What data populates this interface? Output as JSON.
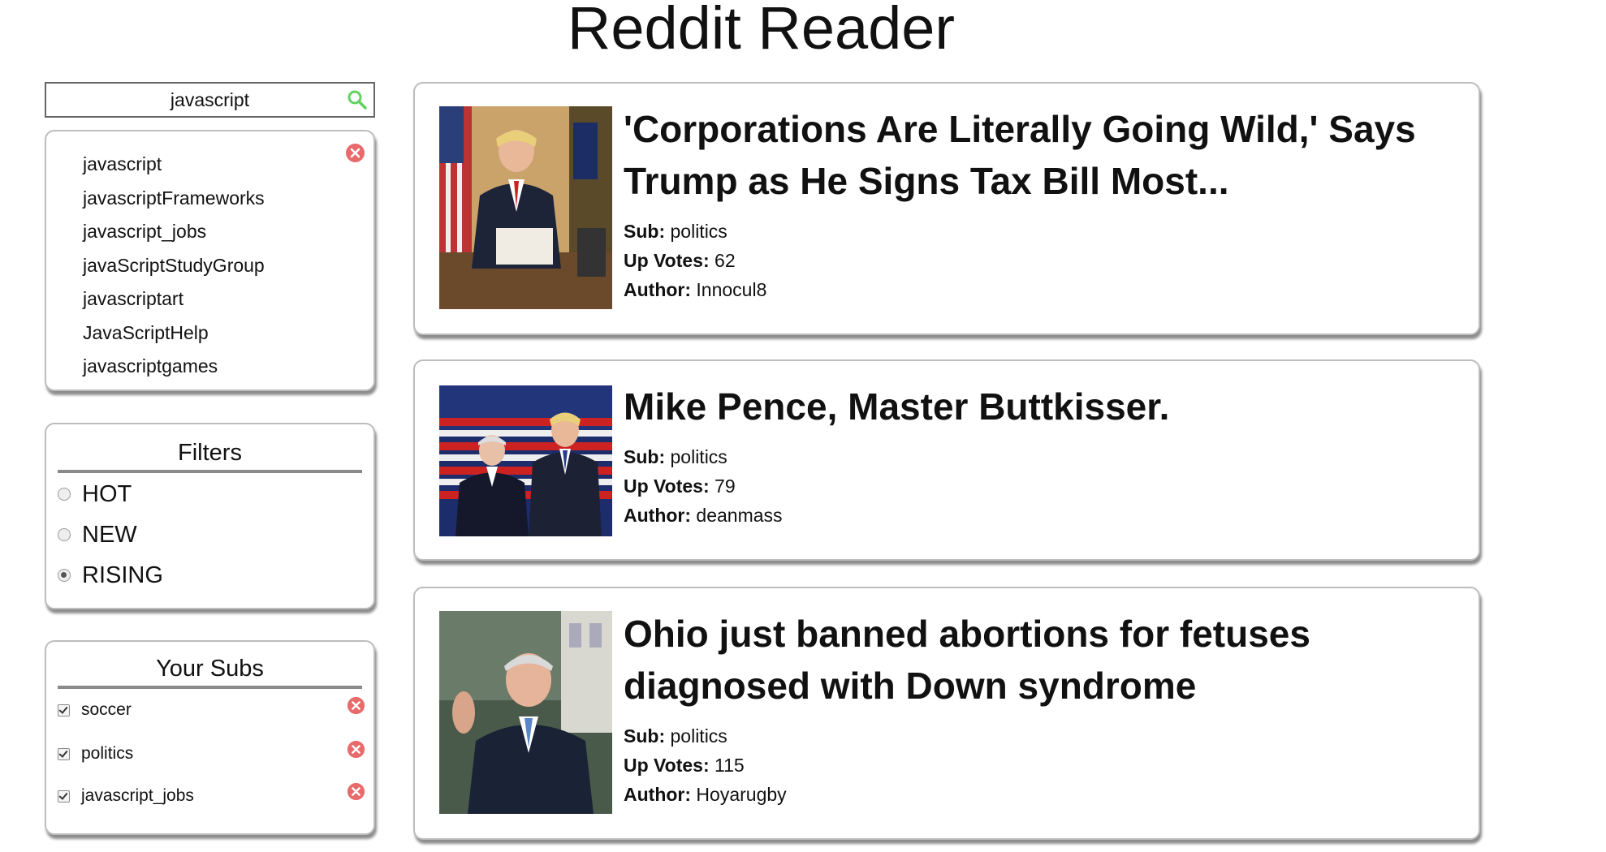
{
  "app": {
    "title": "Reddit Reader"
  },
  "search": {
    "value": "javascript",
    "placeholder": ""
  },
  "suggestions": [
    "javascript",
    "javascriptFrameworks",
    "javascript_jobs",
    "javaScriptStudyGroup",
    "javascriptart",
    "JavaScriptHelp",
    "javascriptgames"
  ],
  "filters": {
    "title": "Filters",
    "options": [
      {
        "label": "HOT",
        "checked": false
      },
      {
        "label": "NEW",
        "checked": false
      },
      {
        "label": "RISING",
        "checked": true
      }
    ]
  },
  "subs": {
    "title": "Your Subs",
    "items": [
      {
        "label": "soccer",
        "checked": true
      },
      {
        "label": "politics",
        "checked": true
      },
      {
        "label": "javascript_jobs",
        "checked": true
      }
    ]
  },
  "meta_labels": {
    "sub": "Sub:",
    "votes": "Up Votes:",
    "author": "Author:"
  },
  "posts": [
    {
      "title": "'Corporations Are Literally Going Wild,' Says Trump as He Signs Tax Bill Most...",
      "sub": "politics",
      "votes": "62",
      "author": "Innocul8"
    },
    {
      "title": "Mike Pence, Master Buttkisser.",
      "sub": "politics",
      "votes": "79",
      "author": "deanmass"
    },
    {
      "title": "Ohio just banned abortions for fetuses diagnosed with Down syndrome",
      "sub": "politics",
      "votes": "115",
      "author": "Hoyarugby"
    }
  ],
  "colors": {
    "accent_green": "#5fd35f",
    "close_red": "#e86a6a",
    "divider": "#8a8a8a"
  }
}
